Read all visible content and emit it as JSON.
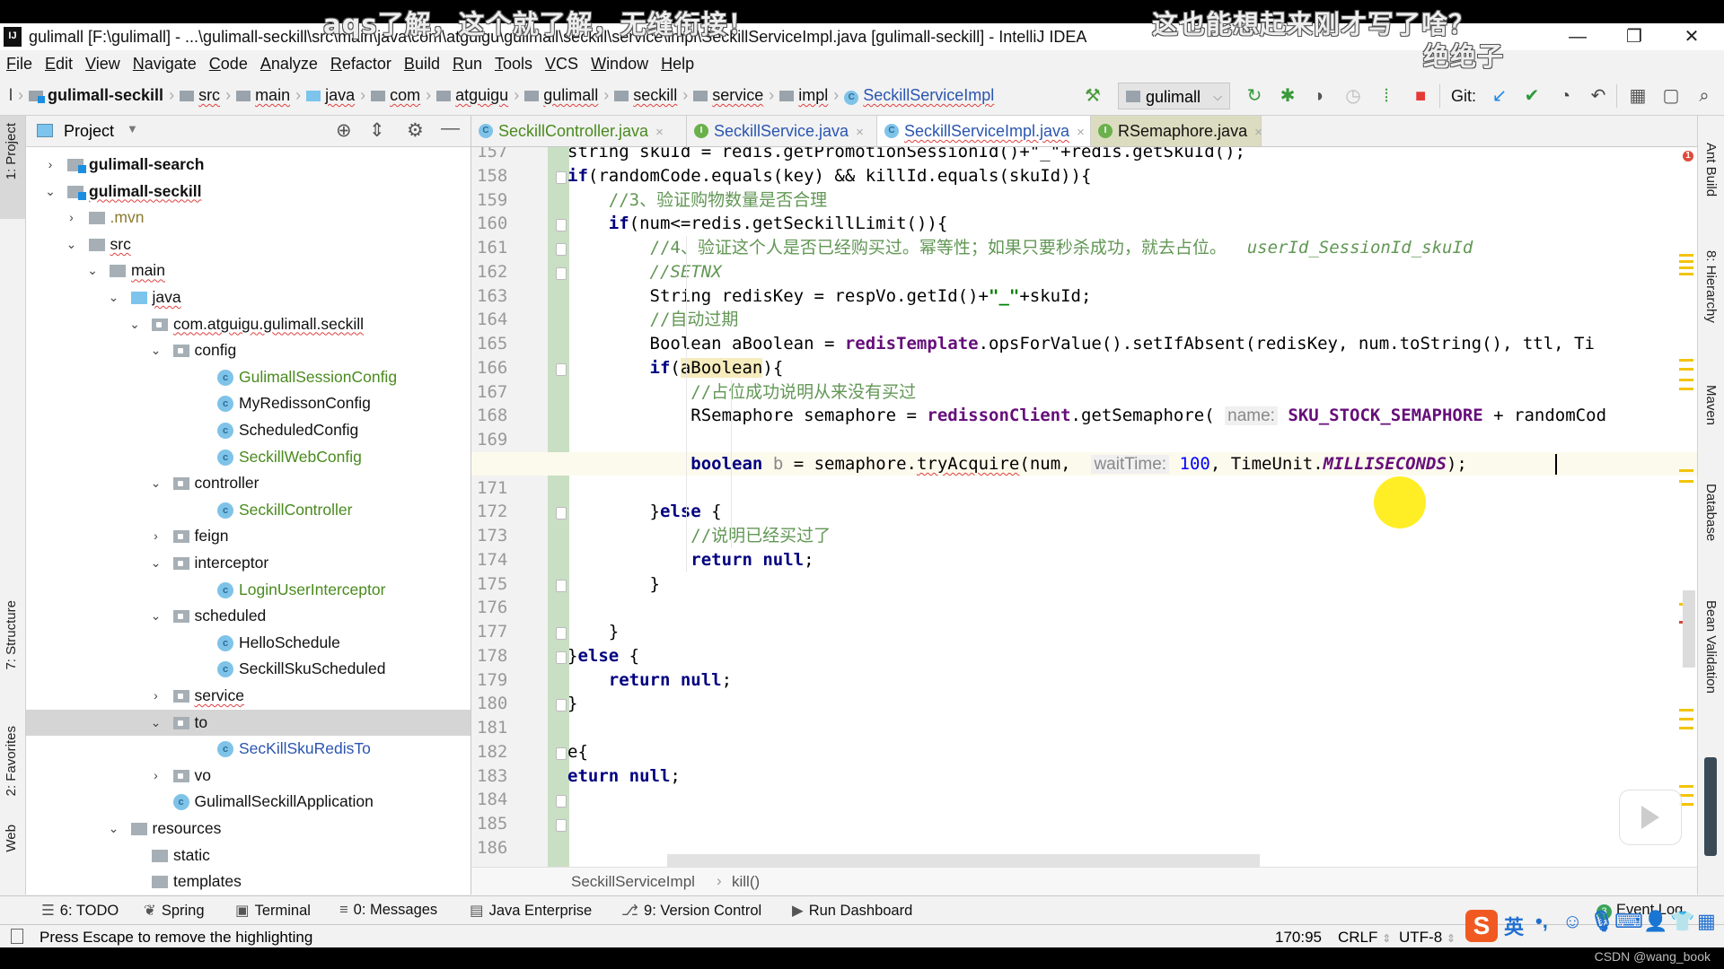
{
  "subtitles": {
    "left": "aqs了解，这个就了解，无缝衔接！",
    "right": "这也能想起来刚才写了啥？",
    "right2": "绝绝子"
  },
  "window": {
    "title": "gulimall [F:\\gulimall] - ...\\gulimall-seckill\\src\\main\\java\\com\\atguigu\\gulimall\\seckill\\service\\impl\\SeckillServiceImpl.java [gulimall-seckill] - IntelliJ IDEA",
    "logo": "IJ",
    "minimize": "—",
    "restore": "❐",
    "close": "✕"
  },
  "menu": [
    "File",
    "Edit",
    "View",
    "Navigate",
    "Code",
    "Analyze",
    "Refactor",
    "Build",
    "Run",
    "Tools",
    "VCS",
    "Window",
    "Help"
  ],
  "breadcrumbs": [
    "gulimall-seckill",
    "src",
    "main",
    "java",
    "com",
    "atguigu",
    "gulimall",
    "seckill",
    "service",
    "impl",
    "SeckillServiceImpl"
  ],
  "toolbar": {
    "run_config": "gulimall",
    "git_label": "Git:"
  },
  "project_panel": {
    "title": "Project",
    "tree": [
      {
        "label": "gulimall-search",
        "depth": 0,
        "type": "module",
        "expanded": false,
        "bold": true
      },
      {
        "label": "gulimall-seckill",
        "depth": 0,
        "type": "module",
        "expanded": true,
        "bold": true
      },
      {
        "label": ".mvn",
        "depth": 1,
        "type": "folder",
        "expanded": false
      },
      {
        "label": "src",
        "depth": 1,
        "type": "folder",
        "expanded": true
      },
      {
        "label": "main",
        "depth": 2,
        "type": "folder",
        "expanded": true
      },
      {
        "label": "java",
        "depth": 3,
        "type": "source",
        "expanded": true
      },
      {
        "label": "com.atguigu.gulimall.seckill",
        "depth": 4,
        "type": "package",
        "expanded": true
      },
      {
        "label": "config",
        "depth": 5,
        "type": "package",
        "expanded": true
      },
      {
        "label": "GulimallSessionConfig",
        "depth": 6,
        "type": "class",
        "color": "#4a8a1e"
      },
      {
        "label": "MyRedissonConfig",
        "depth": 6,
        "type": "class"
      },
      {
        "label": "ScheduledConfig",
        "depth": 6,
        "type": "class"
      },
      {
        "label": "SeckillWebConfig",
        "depth": 6,
        "type": "class",
        "color": "#4a8a1e"
      },
      {
        "label": "controller",
        "depth": 5,
        "type": "package",
        "expanded": true
      },
      {
        "label": "SeckillController",
        "depth": 6,
        "type": "class",
        "color": "#4a8a1e"
      },
      {
        "label": "feign",
        "depth": 5,
        "type": "package",
        "expanded": false
      },
      {
        "label": "interceptor",
        "depth": 5,
        "type": "package",
        "expanded": true
      },
      {
        "label": "LoginUserInterceptor",
        "depth": 6,
        "type": "class",
        "color": "#4a8a1e"
      },
      {
        "label": "scheduled",
        "depth": 5,
        "type": "package",
        "expanded": true
      },
      {
        "label": "HelloSchedule",
        "depth": 6,
        "type": "class"
      },
      {
        "label": "SeckillSkuScheduled",
        "depth": 6,
        "type": "class"
      },
      {
        "label": "service",
        "depth": 5,
        "type": "package",
        "expanded": false
      },
      {
        "label": "to",
        "depth": 5,
        "type": "package",
        "expanded": true,
        "selected": true
      },
      {
        "label": "SecKillSkuRedisTo",
        "depth": 6,
        "type": "class",
        "color": "#2a55b0"
      },
      {
        "label": "vo",
        "depth": 5,
        "type": "package",
        "expanded": false
      },
      {
        "label": "GulimallSeckillApplication",
        "depth": 5,
        "type": "app"
      },
      {
        "label": "resources",
        "depth": 3,
        "type": "resources",
        "expanded": true
      },
      {
        "label": "static",
        "depth": 4,
        "type": "folder"
      },
      {
        "label": "templates",
        "depth": 4,
        "type": "folder"
      }
    ]
  },
  "tabs": [
    {
      "label": "SeckillController.java",
      "icon": "C",
      "color": "#4a8a1e",
      "active": false
    },
    {
      "label": "SeckillService.java",
      "icon": "I",
      "color": "#2a55b0",
      "active": false
    },
    {
      "label": "SeckillServiceImpl.java",
      "icon": "C",
      "color": "#2a55b0",
      "active": true
    },
    {
      "label": "RSemaphore.java",
      "icon": "I",
      "color": "#111",
      "active": false
    }
  ],
  "editor": {
    "first_line": 157,
    "current_line": 170,
    "lines": [
      "<span>string skuId = redis.getPromotionSessionId()+\"_\"+redis.getSkuId();</span>",
      "<span class=\"kw\">if</span>(randomCode.equals(key) &amp;&amp; killId.equals(skuId)){",
      "    <span class=\"cm\">//3、验证购物数量是否合理</span>",
      "    <span class=\"kw\">if</span>(num&lt;=redis.getSeckillLimit()){",
      "        <span class=\"cm\">//4、验证这个人是否已经购买过。幂等性；如果只要秒杀成功，就去占位。  </span><span class=\"cmi\">userId_SessionId_skuId</span>",
      "        <span class=\"cmi\">//SETNX</span>",
      "        String redisKey = respVo.getId()+<span class=\"str\">\"_\"</span>+skuId;",
      "        <span class=\"cm\">//自动过期</span>",
      "        Boolean aBoolean = <span class=\"fld\">redisTemplate</span>.opsForValue().setIfAbsent(redisKey, num.toString(), ttl, Ti",
      "        <span class=\"kw\">if</span>(<span class=\"hl\">aBoolean</span>){",
      "            <span class=\"cm\">//占位成功说明从来没有买过</span>",
      "            RSemaphore semaphore = <span class=\"fld\">redissonClient</span>.getSemaphore( <span class=\"hint\">name:</span> <span class=\"cst\" style=\"font-style:normal\">SKU_STOCK_SEMAPHORE</span> + randomCod",
      "",
      "            <span class=\"kw\">boolean</span> <span style=\"color:#888\">b</span> = semaphore.<span class=\"wavy\">tryAcquire</span>(num,  <span class=\"hint\">waitTime:</span> <span class=\"num\">100</span>, TimeUnit.<span class=\"cst\">MILLISECONDS</span>);",
      "",
      "        }<span class=\"kw\">else</span> {",
      "            <span class=\"cm\">//说明已经买过了</span>",
      "            <span class=\"kw\">return null</span>;",
      "        }",
      "",
      "    }",
      "}<span class=\"kw\">else</span> {",
      "    <span class=\"kw\">return null</span>;",
      "}",
      "",
      "e{",
      "<span class=\"kw\">eturn null</span>;",
      "",
      "",
      ""
    ],
    "breadcrumb": [
      "SeckillServiceImpl",
      "kill()"
    ]
  },
  "right_tools": [
    "Ant Build",
    "8: Hierarchy",
    "Maven",
    "Database",
    "Bean Validation"
  ],
  "left_tools": [
    "1: Project",
    "7: Structure",
    "2: Favorites",
    "Web"
  ],
  "bottom_tools": [
    {
      "label": "6: TODO",
      "icon": "☰"
    },
    {
      "label": "Spring",
      "icon": "❦"
    },
    {
      "label": "Terminal",
      "icon": "▣"
    },
    {
      "label": "0: Messages",
      "icon": "≡"
    },
    {
      "label": "Java Enterprise",
      "icon": "▤"
    },
    {
      "label": "9: Version Control",
      "icon": "⎇"
    },
    {
      "label": "Run Dashboard",
      "icon": "▶"
    }
  ],
  "event_log": {
    "label": "Event Log",
    "count": "3"
  },
  "status": {
    "message": "Press Escape to remove the highlighting",
    "position": "170:95",
    "line_sep": "CRLF",
    "encoding": "UTF-8",
    "ime_lang": "英"
  },
  "watermark": "CSDN @wang_book",
  "error_count": "1"
}
